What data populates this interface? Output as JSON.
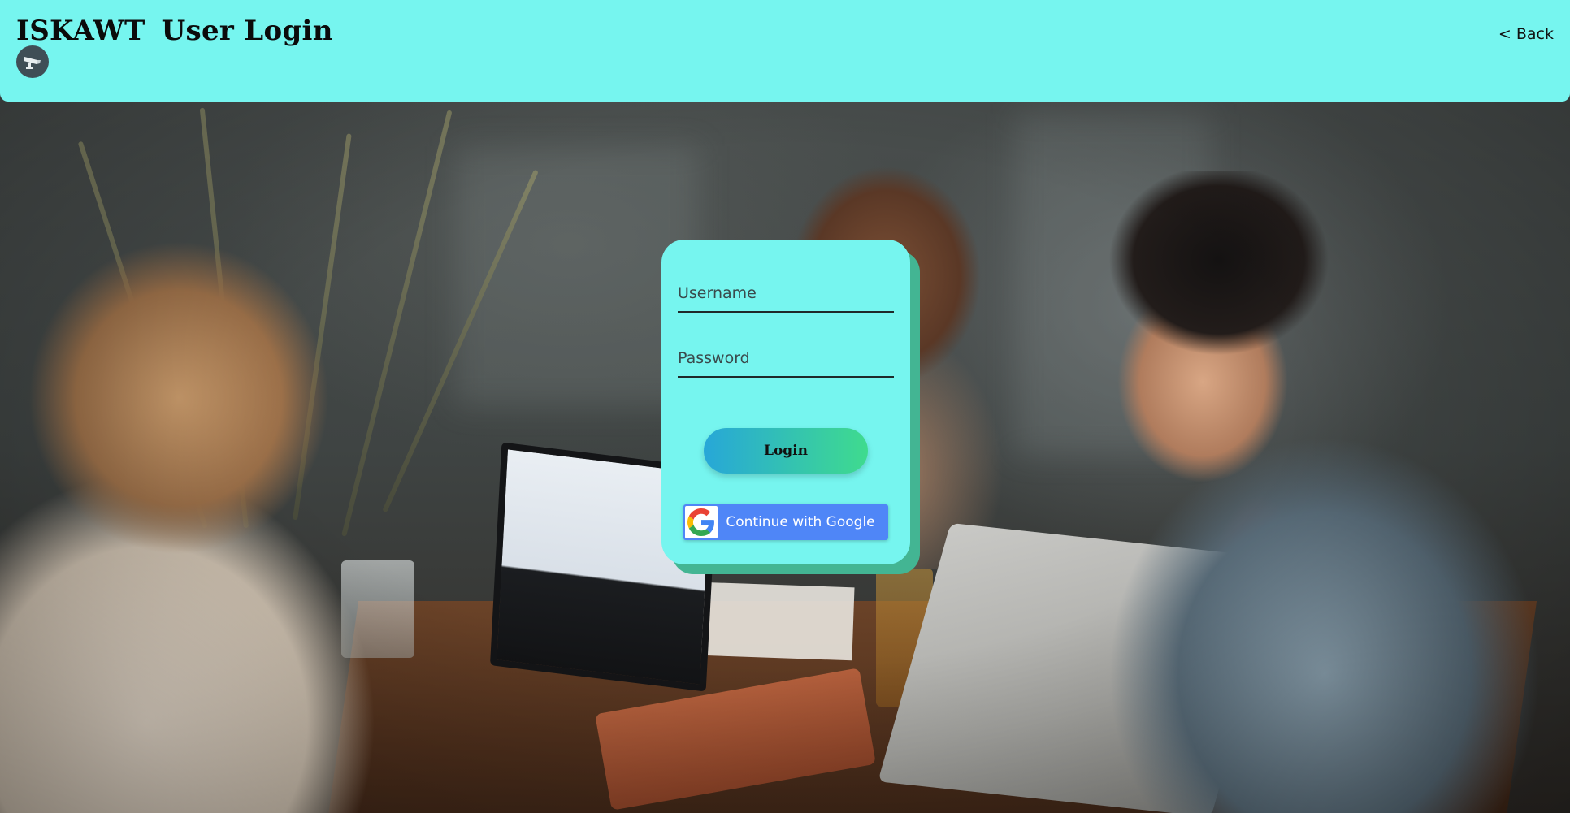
{
  "header": {
    "brand": "ISKAWT",
    "title": "User Login",
    "logo_icon": "security-camera-icon",
    "back_label": "< Back"
  },
  "login_form": {
    "username_placeholder": "Username",
    "username_value": "",
    "password_placeholder": "Password",
    "password_value": "",
    "login_label": "Login",
    "google_label": "Continue with Google",
    "google_icon": "google-icon"
  },
  "colors": {
    "header_bg": "#76f5ef",
    "card_bg": "#76f5ef",
    "card_shadow": "#43b593",
    "login_gradient_start": "#27a7d8",
    "login_gradient_end": "#3fdb8e",
    "google_button": "#4f86f7"
  },
  "background": {
    "description": "photo-background"
  }
}
